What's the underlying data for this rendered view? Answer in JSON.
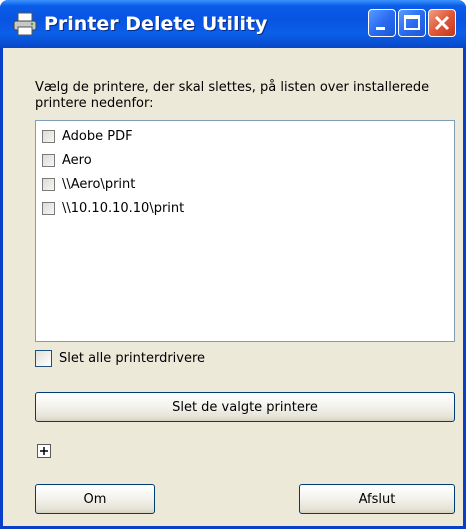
{
  "window": {
    "title": "Printer Delete Utility",
    "title_icon": "printer-icon",
    "controls": [
      "minimize-icon",
      "maximize-icon",
      "close-icon"
    ]
  },
  "instruction": "Vælg de printere, der skal slettes, på listen over installerede printere nedenfor:",
  "printers": [
    {
      "label": "Adobe PDF",
      "checked": false
    },
    {
      "label": "Aero",
      "checked": false
    },
    {
      "label": "\\\\Aero\\print",
      "checked": false
    },
    {
      "label": "\\\\10.10.10.10\\print",
      "checked": false
    }
  ],
  "delete_all_drivers": {
    "label": "Slet alle printerdrivere",
    "checked": false
  },
  "buttons": {
    "delete_selected": "Slet de valgte printere",
    "about": "Om",
    "exit": "Afslut"
  },
  "expander_icon": "plus-icon"
}
